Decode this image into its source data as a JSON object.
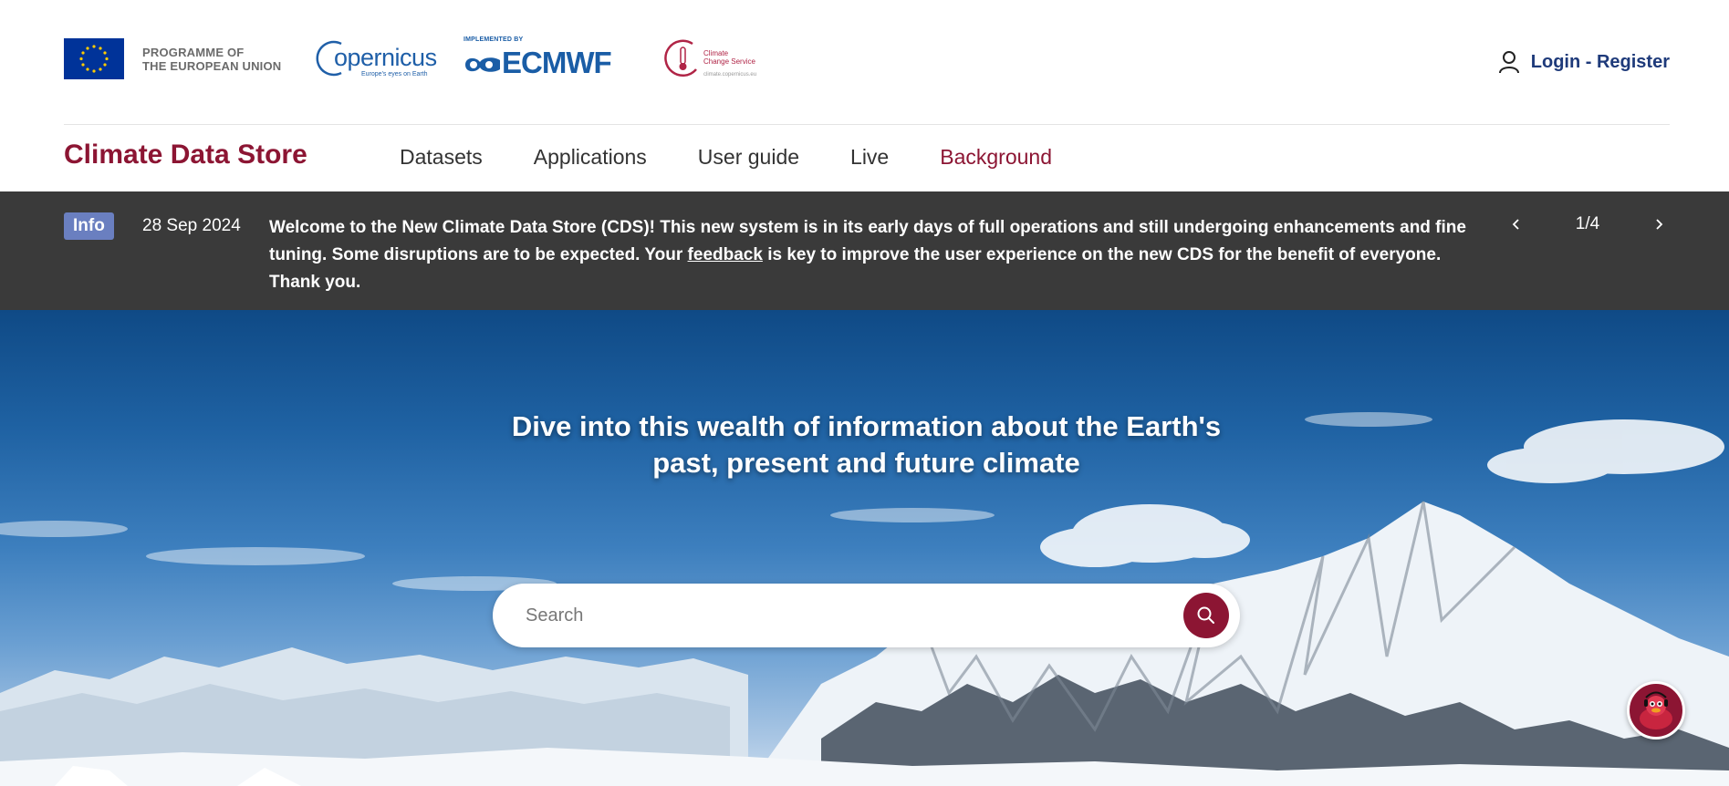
{
  "header": {
    "eu_text_line1": "PROGRAMME OF",
    "eu_text_line2": "THE EUROPEAN UNION",
    "copernicus_word": "opernicus",
    "copernicus_tagline": "Europe's eyes on Earth",
    "ecmwf_implemented": "IMPLEMENTED BY",
    "ecmwf_word": "ECMWF",
    "c3s_line1": "Climate",
    "c3s_line2": "Change Service",
    "c3s_url": "climate.copernicus.eu",
    "login_label": "Login - Register"
  },
  "nav": {
    "brand": "Climate Data Store",
    "items": [
      {
        "label": "Datasets"
      },
      {
        "label": "Applications"
      },
      {
        "label": "User guide"
      },
      {
        "label": "Live"
      },
      {
        "label": "Background"
      }
    ]
  },
  "banner": {
    "badge": "Info",
    "date": "28 Sep 2024",
    "msg_before_link": "Welcome to the New Climate Data Store (CDS)! This new system is in its early days of full operations and still undergoing enhancements and fine tuning. Some disruptions are to be expected. Your ",
    "link_text": "feedback",
    "msg_after_link": " is key to improve the user experience on the new CDS for the benefit of everyone. Thank you.",
    "pager": "1/4"
  },
  "hero": {
    "title": "Dive into this wealth of information about the Earth's past, present and future climate",
    "search_placeholder": "Search"
  },
  "icons": {
    "user": "user-icon",
    "prev": "chevron-left-icon",
    "next": "chevron-right-icon",
    "search": "search-icon",
    "chat": "duck-assistant-icon"
  },
  "colors": {
    "brand": "#8c1533",
    "link": "#1e3a7a",
    "banner_bg": "#3a3a3a",
    "badge": "#6a7fc0"
  }
}
